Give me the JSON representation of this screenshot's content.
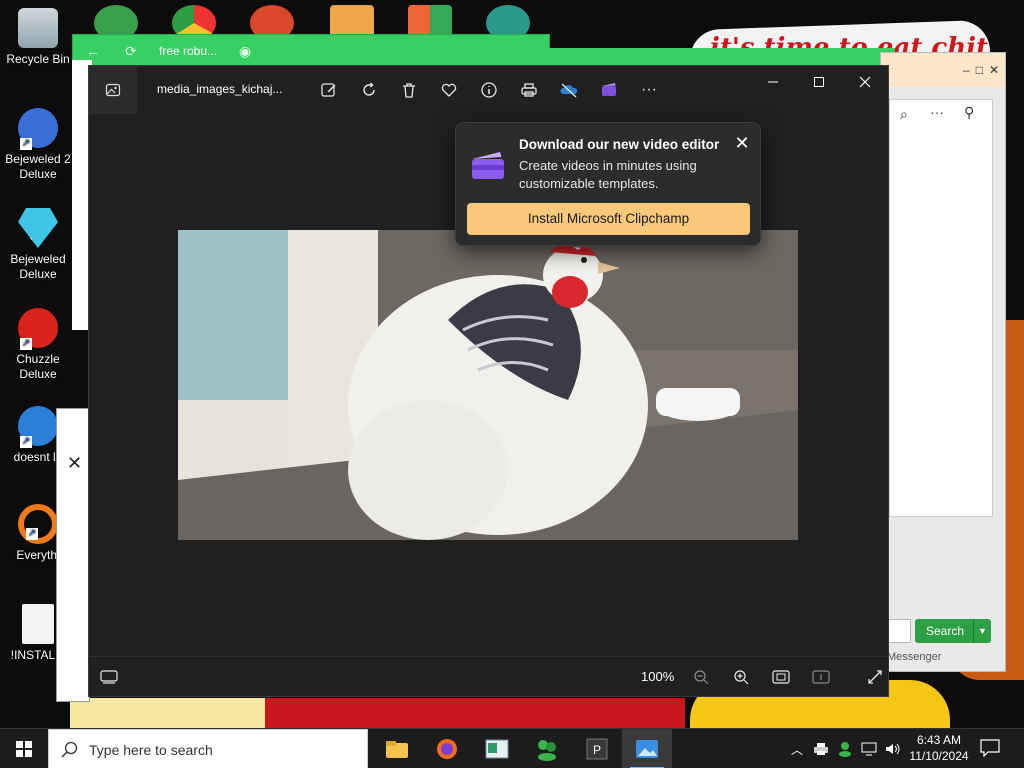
{
  "desktop": {
    "wallpaper_text": "it's time to eat chit",
    "icons": [
      {
        "label": "Recycle Bin"
      },
      {
        "label": "Bejeweled 2 Deluxe"
      },
      {
        "label": "Bejeweled Deluxe"
      },
      {
        "label": "Chuzzle Deluxe"
      },
      {
        "label": "doesnt lo"
      },
      {
        "label": "Everythi"
      },
      {
        "label": "!INSTALLI"
      }
    ]
  },
  "background_window": {
    "title": "free robu..."
  },
  "right_window": {
    "search_button": "Search",
    "footer_text": "Messenger"
  },
  "photos": {
    "filename": "media_images_kichaj...",
    "zoom_level": "100%",
    "image_subject": "white hen"
  },
  "popup": {
    "title": "Download our new video editor",
    "body": "Create videos in minutes using customizable templates.",
    "button": "Install Microsoft Clipchamp"
  },
  "taskbar": {
    "search_placeholder": "Type here to search",
    "time": "6:43 AM",
    "date": "11/10/2024"
  },
  "colors": {
    "accent_green": "#37d063",
    "popup_button": "#f9c878",
    "photos_bg": "#202020"
  }
}
